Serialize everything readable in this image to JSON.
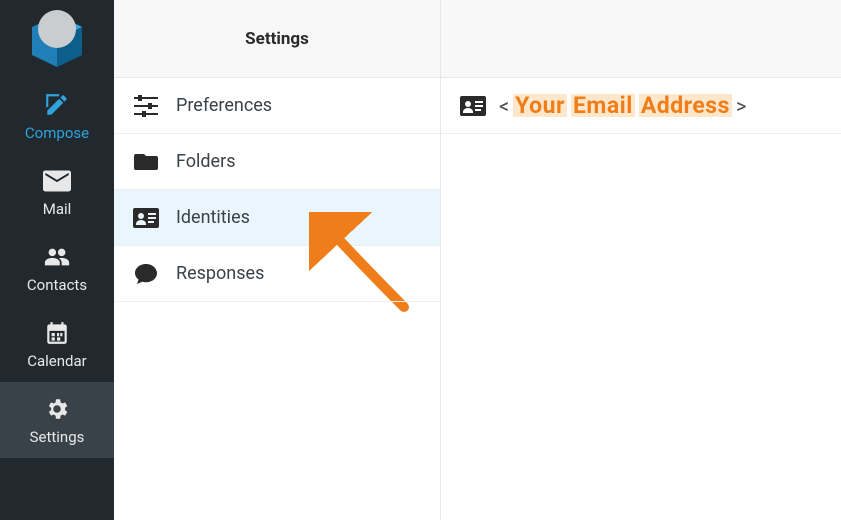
{
  "nav": {
    "compose": "Compose",
    "mail": "Mail",
    "contacts": "Contacts",
    "calendar": "Calendar",
    "settings": "Settings"
  },
  "settings": {
    "header": "Settings",
    "items": {
      "preferences": "Preferences",
      "folders": "Folders",
      "identities": "Identities",
      "responses": "Responses"
    }
  },
  "identity": {
    "open_bracket": "<",
    "close_bracket": ">",
    "placeholder_w1": "Your",
    "placeholder_w2": "Email",
    "placeholder_w3": "Address"
  }
}
